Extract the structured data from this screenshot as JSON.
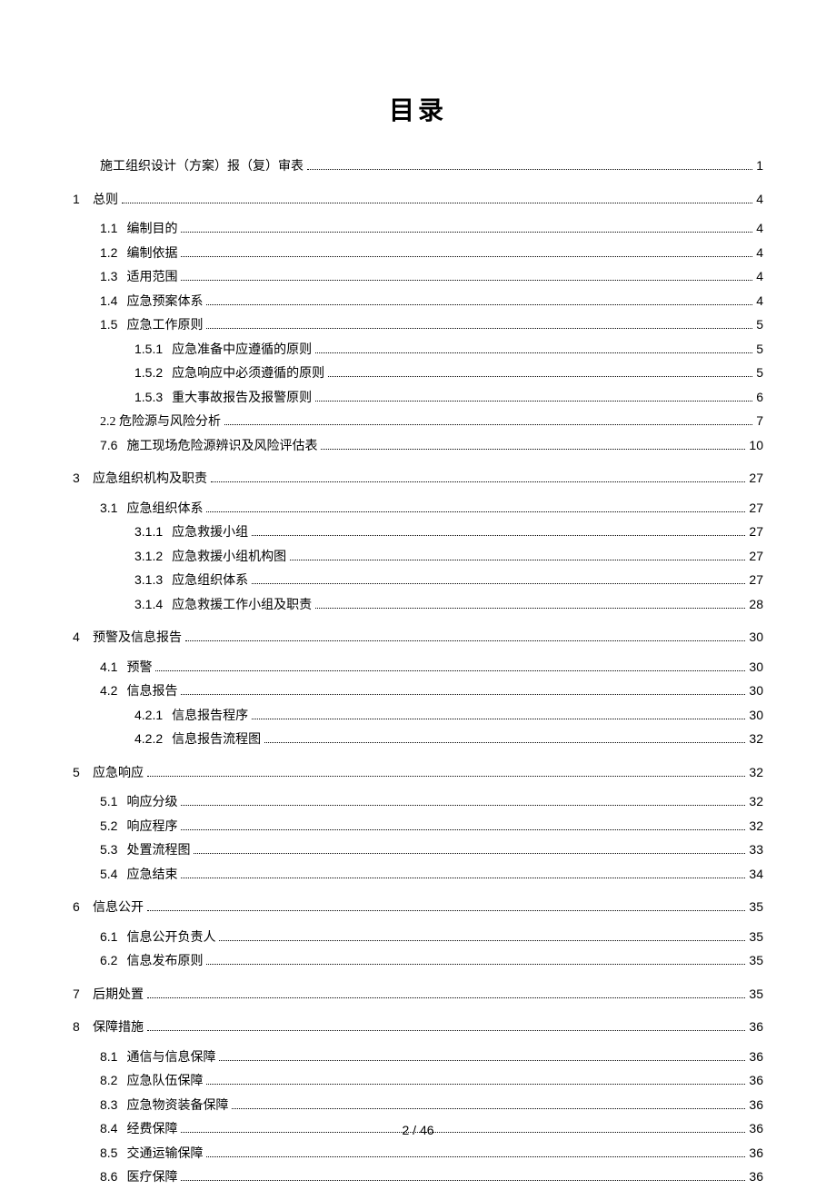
{
  "title": "目录",
  "footer": "2 / 46",
  "toc": [
    {
      "level": 1,
      "num": "",
      "text": "施工组织设计（方案）报（复）审表",
      "page": "1",
      "noTopLevelGap": true
    },
    {
      "level": 0,
      "num": "1",
      "text": "总则",
      "page": "4"
    },
    {
      "level": 1,
      "num": "1.1",
      "text": "编制目的",
      "page": "4",
      "firstSub": true
    },
    {
      "level": 1,
      "num": "1.2",
      "text": "编制依据",
      "page": "4"
    },
    {
      "level": 1,
      "num": "1.3",
      "text": "适用范围",
      "page": "4"
    },
    {
      "level": 1,
      "num": "1.4",
      "text": "应急预案体系",
      "page": "4"
    },
    {
      "level": 1,
      "num": "1.5",
      "text": "应急工作原则",
      "page": "5"
    },
    {
      "level": 2,
      "num": "1.5.1",
      "text": "应急准备中应遵循的原则",
      "page": "5"
    },
    {
      "level": 2,
      "num": "1.5.2",
      "text": "应急响应中必须遵循的原则",
      "page": "5"
    },
    {
      "level": 2,
      "num": "1.5.3",
      "text": "重大事故报告及报警原则",
      "page": "6"
    },
    {
      "level": 1,
      "num": "",
      "text": "2.2 危险源与风险分析",
      "page": "7",
      "raw": true
    },
    {
      "level": 1,
      "num": "7.6",
      "text": "施工现场危险源辨识及风险评估表",
      "page": "10"
    },
    {
      "level": 0,
      "num": "3",
      "text": "应急组织机构及职责",
      "page": "27"
    },
    {
      "level": 1,
      "num": "3.1",
      "text": "应急组织体系",
      "page": "27",
      "firstSub": true
    },
    {
      "level": 2,
      "num": "3.1.1",
      "text": "应急救援小组",
      "page": "27"
    },
    {
      "level": 2,
      "num": "3.1.2",
      "text": "应急救援小组机构图",
      "page": "27"
    },
    {
      "level": 2,
      "num": "3.1.3",
      "text": "应急组织体系",
      "page": "27"
    },
    {
      "level": 2,
      "num": "3.1.4",
      "text": "应急救援工作小组及职责",
      "page": "28"
    },
    {
      "level": 0,
      "num": "4",
      "text": "预警及信息报告",
      "page": "30"
    },
    {
      "level": 1,
      "num": "4.1",
      "text": "预警",
      "page": "30",
      "firstSub": true
    },
    {
      "level": 1,
      "num": "4.2",
      "text": "信息报告",
      "page": "30"
    },
    {
      "level": 2,
      "num": "4.2.1",
      "text": "信息报告程序",
      "page": "30"
    },
    {
      "level": 2,
      "num": "4.2.2",
      "text": "信息报告流程图",
      "page": "32"
    },
    {
      "level": 0,
      "num": "5",
      "text": "应急响应",
      "page": "32"
    },
    {
      "level": 1,
      "num": "5.1",
      "text": "响应分级",
      "page": "32",
      "firstSub": true
    },
    {
      "level": 1,
      "num": "5.2",
      "text": "响应程序",
      "page": "32"
    },
    {
      "level": 1,
      "num": "5.3",
      "text": "处置流程图",
      "page": "33"
    },
    {
      "level": 1,
      "num": "5.4",
      "text": "应急结束",
      "page": "34"
    },
    {
      "level": 0,
      "num": "6",
      "text": "信息公开",
      "page": "35"
    },
    {
      "level": 1,
      "num": "6.1",
      "text": "信息公开负责人",
      "page": "35",
      "firstSub": true
    },
    {
      "level": 1,
      "num": "6.2",
      "text": "信息发布原则",
      "page": "35"
    },
    {
      "level": 0,
      "num": "7",
      "text": "后期处置",
      "page": "35"
    },
    {
      "level": 0,
      "num": "8",
      "text": "保障措施",
      "page": "36"
    },
    {
      "level": 1,
      "num": "8.1",
      "text": "通信与信息保障",
      "page": "36",
      "firstSub": true
    },
    {
      "level": 1,
      "num": "8.2",
      "text": "应急队伍保障",
      "page": "36"
    },
    {
      "level": 1,
      "num": "8.3",
      "text": "应急物资装备保障",
      "page": "36"
    },
    {
      "level": 1,
      "num": "8.4",
      "text": "经费保障",
      "page": "36"
    },
    {
      "level": 1,
      "num": "8.5",
      "text": "交通运输保障",
      "page": "36"
    },
    {
      "level": 1,
      "num": "8.6",
      "text": "医疗保障",
      "page": "36"
    }
  ]
}
